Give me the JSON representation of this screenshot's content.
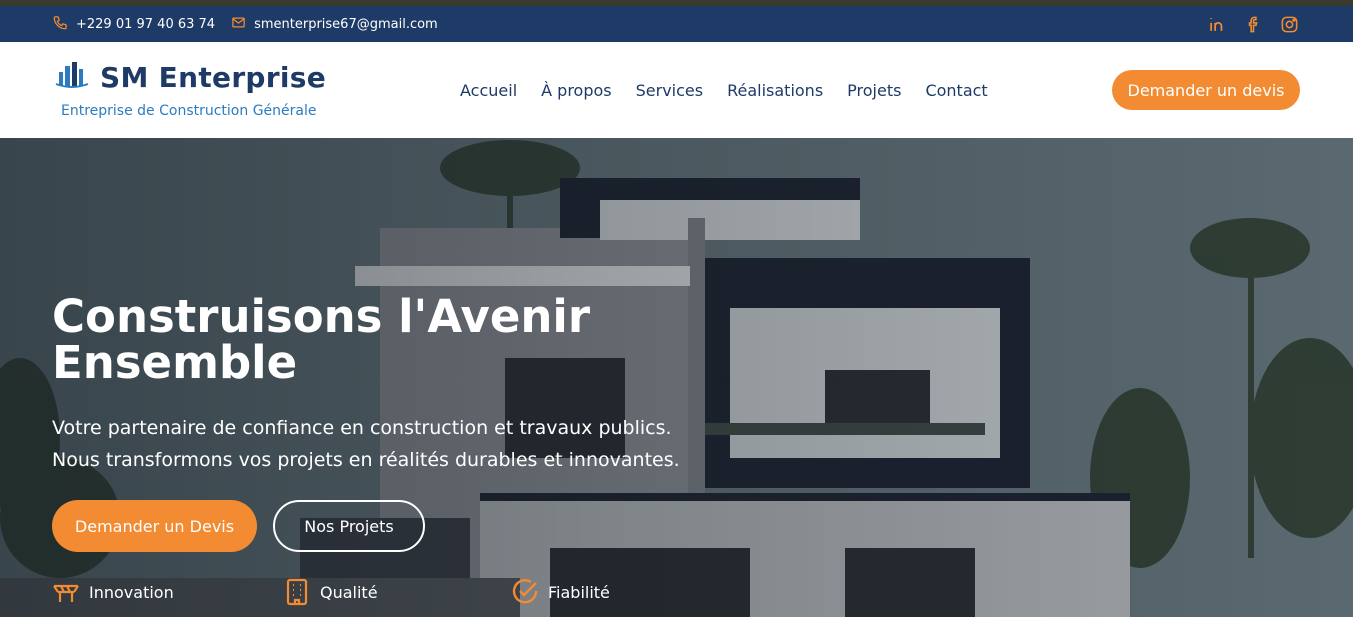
{
  "topbar": {
    "phone": "+229 01 97 40 63 74",
    "email": "smenterprise67@gmail.com",
    "icons": [
      "phone-icon",
      "mail-icon",
      "linkedin-icon",
      "facebook-icon",
      "instagram-icon"
    ]
  },
  "brand": {
    "name": "SM Enterprise",
    "tagline": "Entreprise de Construction Générale"
  },
  "nav": {
    "items": [
      "Accueil",
      "À propos",
      "Services",
      "Réalisations",
      "Projets",
      "Contact"
    ],
    "cta": "Demander un devis"
  },
  "hero": {
    "title": "Construisons l'Avenir Ensemble",
    "subtitle": "Votre partenaire de confiance en construction et travaux publics. Nous transformons vos projets en réalités durables et innovantes.",
    "primary_button": "Demander un Devis",
    "secondary_button": "Nos Projets",
    "features": [
      {
        "label": "Innovation",
        "icon": "innovation-icon"
      },
      {
        "label": "Qualité",
        "icon": "building-icon"
      },
      {
        "label": "Fiabilité",
        "icon": "check-circle-icon"
      }
    ]
  },
  "colors": {
    "topbar": "#1e3a66",
    "accent": "#f28b32",
    "brand": "#1e3a66",
    "tagline": "#2c7bc0"
  }
}
